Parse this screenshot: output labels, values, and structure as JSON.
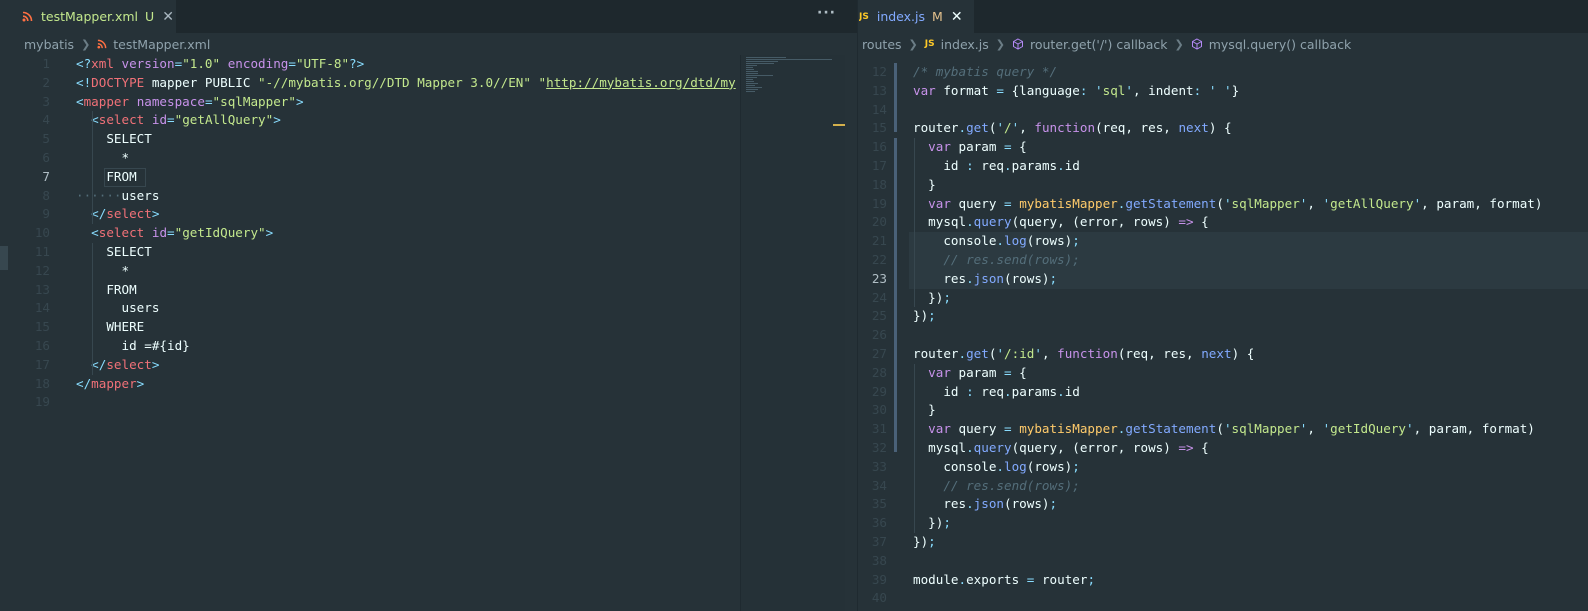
{
  "colors": {
    "background": "#263238",
    "tab_bar": "#1e282d",
    "keyword_purple": "#c792ea",
    "tag_red": "#f07178",
    "string_green": "#c3e88d",
    "function_blue": "#82aaff",
    "punctuation_cyan": "#89ddff",
    "variable_yellow": "#ffcb6b",
    "comment_gray": "#546e7a",
    "untracked": "#c3e88d",
    "modified": "#e2c08d"
  },
  "left": {
    "tab": {
      "icon": "rss-icon",
      "name": "testMapper.xml",
      "status": "U",
      "close": "✕"
    },
    "more": "···",
    "breadcrumb": [
      "mybatis",
      "testMapper.xml"
    ],
    "lines": [
      {
        "n": "1",
        "t": [
          [
            "<?",
            "p"
          ],
          [
            "xml",
            "r"
          ],
          [
            " ",
            "w"
          ],
          [
            "version",
            "v"
          ],
          [
            "=",
            "p"
          ],
          [
            "\"1.0\"",
            "s"
          ],
          [
            " ",
            "w"
          ],
          [
            "encoding",
            "v"
          ],
          [
            "=",
            "p"
          ],
          [
            "\"UTF-8\"",
            "s"
          ],
          [
            "?>",
            "p"
          ]
        ]
      },
      {
        "n": "2",
        "t": [
          [
            "<!",
            "p"
          ],
          [
            "DOCTYPE",
            "r"
          ],
          [
            " mapper PUBLIC ",
            "w"
          ],
          [
            "\"-//mybatis.org//DTD Mapper 3.0//EN\"",
            "s"
          ],
          [
            " ",
            "w"
          ],
          [
            "\"",
            "s"
          ],
          [
            "http://mybatis.org/dtd/my",
            "su"
          ]
        ]
      },
      {
        "n": "3",
        "t": [
          [
            "<",
            "p"
          ],
          [
            "mapper",
            "r"
          ],
          [
            " ",
            "w"
          ],
          [
            "namespace",
            "v"
          ],
          [
            "=",
            "p"
          ],
          [
            "\"sqlMapper\"",
            "s"
          ],
          [
            ">",
            "p"
          ]
        ]
      },
      {
        "n": "4",
        "t": [
          [
            "  ",
            "w"
          ],
          [
            "<",
            "p"
          ],
          [
            "select",
            "r"
          ],
          [
            " ",
            "w"
          ],
          [
            "id",
            "v"
          ],
          [
            "=",
            "p"
          ],
          [
            "\"getAllQuery\"",
            "s"
          ],
          [
            ">",
            "p"
          ]
        ]
      },
      {
        "n": "5",
        "t": [
          [
            "    SELECT",
            "w"
          ]
        ]
      },
      {
        "n": "6",
        "t": [
          [
            "      *",
            "w"
          ]
        ]
      },
      {
        "n": "7",
        "t": [
          [
            "    FROM",
            "w"
          ]
        ]
      },
      {
        "n": "8",
        "t": [
          [
            "······",
            "ws"
          ],
          [
            "users",
            "w"
          ]
        ]
      },
      {
        "n": "9",
        "t": [
          [
            "  ",
            "w"
          ],
          [
            "</",
            "p"
          ],
          [
            "select",
            "r"
          ],
          [
            ">",
            "p"
          ]
        ]
      },
      {
        "n": "10",
        "t": [
          [
            "  ",
            "w"
          ],
          [
            "<",
            "p"
          ],
          [
            "select",
            "r"
          ],
          [
            " ",
            "w"
          ],
          [
            "id",
            "v"
          ],
          [
            "=",
            "p"
          ],
          [
            "\"getIdQuery\"",
            "s"
          ],
          [
            ">",
            "p"
          ]
        ]
      },
      {
        "n": "11",
        "t": [
          [
            "    SELECT",
            "w"
          ]
        ]
      },
      {
        "n": "12",
        "t": [
          [
            "      *",
            "w"
          ]
        ]
      },
      {
        "n": "13",
        "t": [
          [
            "    FROM",
            "w"
          ]
        ]
      },
      {
        "n": "14",
        "t": [
          [
            "      users",
            "w"
          ]
        ]
      },
      {
        "n": "15",
        "t": [
          [
            "    WHERE",
            "w"
          ]
        ]
      },
      {
        "n": "16",
        "t": [
          [
            "      id =#{id}",
            "w"
          ]
        ]
      },
      {
        "n": "17",
        "t": [
          [
            "  ",
            "w"
          ],
          [
            "</",
            "p"
          ],
          [
            "select",
            "r"
          ],
          [
            ">",
            "p"
          ]
        ]
      },
      {
        "n": "18",
        "t": [
          [
            "</",
            "p"
          ],
          [
            "mapper",
            "r"
          ],
          [
            ">",
            "p"
          ]
        ]
      },
      {
        "n": "19",
        "t": []
      }
    ]
  },
  "right": {
    "tab": {
      "icon_text": "JS",
      "name": "index.js",
      "status": "M",
      "close": "✕"
    },
    "breadcrumb": [
      {
        "label": "routes",
        "icon": ""
      },
      {
        "label": "index.js",
        "icon": "JS"
      },
      {
        "label": "router.get('/') callback",
        "icon": "cube"
      },
      {
        "label": "mysql.query() callback",
        "icon": "cube"
      }
    ],
    "lines": [
      {
        "n": "12",
        "t": [
          [
            "/* mybatis query */",
            "c"
          ]
        ]
      },
      {
        "n": "13",
        "t": [
          [
            "var",
            "k"
          ],
          [
            " format ",
            "w"
          ],
          [
            "=",
            "p"
          ],
          [
            " {language",
            "w"
          ],
          [
            ":",
            "p"
          ],
          [
            " ",
            "w"
          ],
          [
            "'",
            "p"
          ],
          [
            "sql",
            "s"
          ],
          [
            "'",
            "p"
          ],
          [
            ", indent",
            "w"
          ],
          [
            ":",
            "p"
          ],
          [
            " ",
            "w"
          ],
          [
            "'",
            "p"
          ],
          [
            " ",
            "s"
          ],
          [
            "'",
            "p"
          ],
          [
            "}",
            "w"
          ]
        ]
      },
      {
        "n": "14",
        "t": []
      },
      {
        "n": "15",
        "t": [
          [
            "router",
            "w"
          ],
          [
            ".",
            "p"
          ],
          [
            "get",
            "f"
          ],
          [
            "(",
            "w"
          ],
          [
            "'",
            "p"
          ],
          [
            "/",
            "s"
          ],
          [
            "'",
            "p"
          ],
          [
            ", ",
            "w"
          ],
          [
            "function",
            "k"
          ],
          [
            "(req, res, ",
            "w"
          ],
          [
            "next",
            "f"
          ],
          [
            ") {",
            "w"
          ]
        ]
      },
      {
        "n": "16",
        "t": [
          [
            "  ",
            "w"
          ],
          [
            "var",
            "k"
          ],
          [
            " param ",
            "w"
          ],
          [
            "=",
            "p"
          ],
          [
            " {",
            "w"
          ]
        ]
      },
      {
        "n": "17",
        "t": [
          [
            "    id ",
            "w"
          ],
          [
            ":",
            "p"
          ],
          [
            " req",
            "w"
          ],
          [
            ".",
            "p"
          ],
          [
            "params",
            "w"
          ],
          [
            ".",
            "p"
          ],
          [
            "id",
            "w"
          ]
        ]
      },
      {
        "n": "18",
        "t": [
          [
            "  }",
            "w"
          ]
        ]
      },
      {
        "n": "19",
        "t": [
          [
            "  ",
            "w"
          ],
          [
            "var",
            "k"
          ],
          [
            " query ",
            "w"
          ],
          [
            "=",
            "p"
          ],
          [
            " ",
            "w"
          ],
          [
            "mybatisMapper",
            "y"
          ],
          [
            ".",
            "p"
          ],
          [
            "getStatement",
            "f"
          ],
          [
            "(",
            "w"
          ],
          [
            "'",
            "p"
          ],
          [
            "sqlMapper",
            "s"
          ],
          [
            "'",
            "p"
          ],
          [
            ", ",
            "w"
          ],
          [
            "'",
            "p"
          ],
          [
            "getAllQuery",
            "s"
          ],
          [
            "'",
            "p"
          ],
          [
            ", param, format)",
            "w"
          ]
        ]
      },
      {
        "n": "20",
        "t": [
          [
            "  mysql",
            "w"
          ],
          [
            ".",
            "p"
          ],
          [
            "query",
            "f"
          ],
          [
            "(query, (error, rows) ",
            "w"
          ],
          [
            "=>",
            "k"
          ],
          [
            " {",
            "w"
          ]
        ]
      },
      {
        "n": "21",
        "t": [
          [
            "    console",
            "w"
          ],
          [
            ".",
            "p"
          ],
          [
            "log",
            "f"
          ],
          [
            "(rows)",
            "w"
          ],
          [
            ";",
            "p"
          ]
        ]
      },
      {
        "n": "22",
        "t": [
          [
            "    // res.send(rows);",
            "c"
          ]
        ]
      },
      {
        "n": "23",
        "t": [
          [
            "    res",
            "w"
          ],
          [
            ".",
            "p"
          ],
          [
            "json",
            "f"
          ],
          [
            "(rows)",
            "w"
          ],
          [
            ";",
            "p"
          ]
        ]
      },
      {
        "n": "24",
        "t": [
          [
            "  })",
            "w"
          ],
          [
            ";",
            "p"
          ]
        ]
      },
      {
        "n": "25",
        "t": [
          [
            "})",
            "w"
          ],
          [
            ";",
            "p"
          ]
        ]
      },
      {
        "n": "26",
        "t": []
      },
      {
        "n": "27",
        "t": [
          [
            "router",
            "w"
          ],
          [
            ".",
            "p"
          ],
          [
            "get",
            "f"
          ],
          [
            "(",
            "w"
          ],
          [
            "'",
            "p"
          ],
          [
            "/:id",
            "s"
          ],
          [
            "'",
            "p"
          ],
          [
            ", ",
            "w"
          ],
          [
            "function",
            "k"
          ],
          [
            "(req, res, ",
            "w"
          ],
          [
            "next",
            "f"
          ],
          [
            ") {",
            "w"
          ]
        ]
      },
      {
        "n": "28",
        "t": [
          [
            "  ",
            "w"
          ],
          [
            "var",
            "k"
          ],
          [
            " param ",
            "w"
          ],
          [
            "=",
            "p"
          ],
          [
            " {",
            "w"
          ]
        ]
      },
      {
        "n": "29",
        "t": [
          [
            "    id ",
            "w"
          ],
          [
            ":",
            "p"
          ],
          [
            " req",
            "w"
          ],
          [
            ".",
            "p"
          ],
          [
            "params",
            "w"
          ],
          [
            ".",
            "p"
          ],
          [
            "id",
            "w"
          ]
        ]
      },
      {
        "n": "30",
        "t": [
          [
            "  }",
            "w"
          ]
        ]
      },
      {
        "n": "31",
        "t": [
          [
            "  ",
            "w"
          ],
          [
            "var",
            "k"
          ],
          [
            " query ",
            "w"
          ],
          [
            "=",
            "p"
          ],
          [
            " ",
            "w"
          ],
          [
            "mybatisMapper",
            "y"
          ],
          [
            ".",
            "p"
          ],
          [
            "getStatement",
            "f"
          ],
          [
            "(",
            "w"
          ],
          [
            "'",
            "p"
          ],
          [
            "sqlMapper",
            "s"
          ],
          [
            "'",
            "p"
          ],
          [
            ", ",
            "w"
          ],
          [
            "'",
            "p"
          ],
          [
            "getIdQuery",
            "s"
          ],
          [
            "'",
            "p"
          ],
          [
            ", param, format)",
            "w"
          ]
        ]
      },
      {
        "n": "32",
        "t": [
          [
            "  mysql",
            "w"
          ],
          [
            ".",
            "p"
          ],
          [
            "query",
            "f"
          ],
          [
            "(query, (error, rows) ",
            "w"
          ],
          [
            "=>",
            "k"
          ],
          [
            " {",
            "w"
          ]
        ]
      },
      {
        "n": "33",
        "t": [
          [
            "    console",
            "w"
          ],
          [
            ".",
            "p"
          ],
          [
            "log",
            "f"
          ],
          [
            "(rows)",
            "w"
          ],
          [
            ";",
            "p"
          ]
        ]
      },
      {
        "n": "34",
        "t": [
          [
            "    // res.send(rows);",
            "c"
          ]
        ]
      },
      {
        "n": "35",
        "t": [
          [
            "    res",
            "w"
          ],
          [
            ".",
            "p"
          ],
          [
            "json",
            "f"
          ],
          [
            "(rows)",
            "w"
          ],
          [
            ";",
            "p"
          ]
        ]
      },
      {
        "n": "36",
        "t": [
          [
            "  })",
            "w"
          ],
          [
            ";",
            "p"
          ]
        ]
      },
      {
        "n": "37",
        "t": [
          [
            "})",
            "w"
          ],
          [
            ";",
            "p"
          ]
        ]
      },
      {
        "n": "38",
        "t": []
      },
      {
        "n": "39",
        "t": [
          [
            "module",
            "w"
          ],
          [
            ".",
            "p"
          ],
          [
            "exports ",
            "w"
          ],
          [
            "=",
            "p"
          ],
          [
            " router",
            "w"
          ],
          [
            ";",
            "p"
          ]
        ]
      },
      {
        "n": "40",
        "t": []
      }
    ]
  }
}
